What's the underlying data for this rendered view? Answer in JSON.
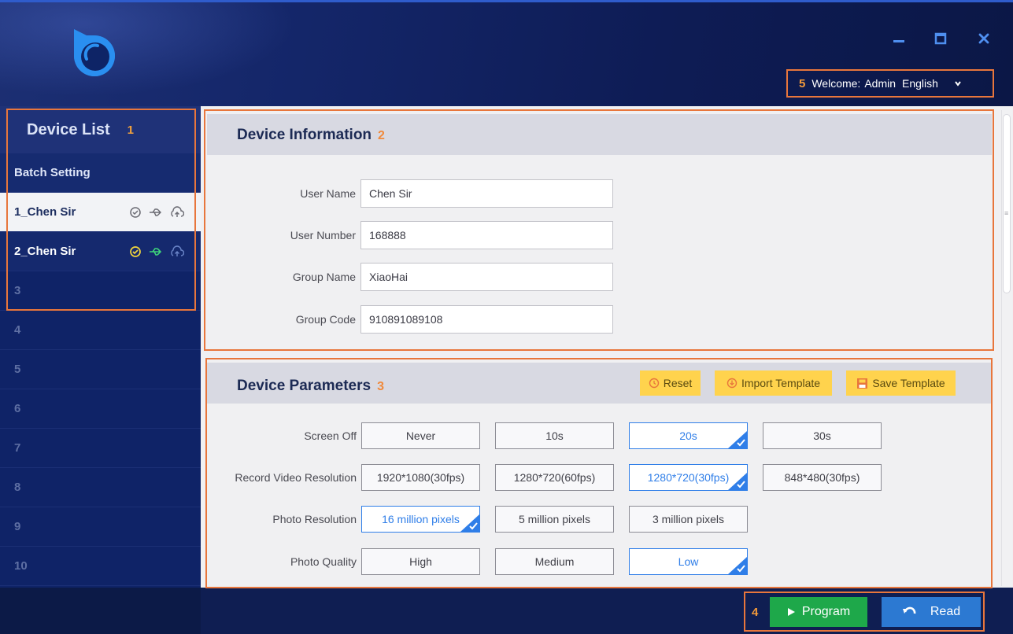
{
  "header": {
    "section_number": "5",
    "welcome_label": "Welcome:",
    "user": "Admin",
    "language": "English",
    "icons": {
      "logo": "app-logo",
      "minimize": "minimize-icon",
      "maximize": "maximize-icon",
      "close": "close-icon",
      "dropdown": "chevron-down-icon"
    }
  },
  "sidebar": {
    "title": "Device List",
    "section_number": "1",
    "batch_label": "Batch Setting",
    "items": [
      {
        "label": "1_Chen Sir",
        "active": true
      },
      {
        "label": "2_Chen Sir",
        "active": false
      },
      {
        "label": "3"
      },
      {
        "label": "4"
      },
      {
        "label": "5"
      },
      {
        "label": "6"
      },
      {
        "label": "7"
      },
      {
        "label": "8"
      },
      {
        "label": "9"
      },
      {
        "label": "10"
      }
    ]
  },
  "device_info": {
    "title": "Device Information",
    "section_number": "2",
    "fields": [
      {
        "label": "User Name",
        "value": "Chen Sir"
      },
      {
        "label": "User Number",
        "value": "168888"
      },
      {
        "label": "Group Name",
        "value": "XiaoHai"
      },
      {
        "label": "Group Code",
        "value": "910891089108"
      }
    ]
  },
  "device_params": {
    "title": "Device Parameters",
    "section_number": "3",
    "buttons": {
      "reset": "Reset",
      "import": "Import Template",
      "save": "Save Template"
    },
    "rows": [
      {
        "label": "Screen Off",
        "options": [
          "Never",
          "10s",
          "20s",
          "30s"
        ],
        "selected": "20s"
      },
      {
        "label": "Record Video Resolution",
        "options": [
          "1920*1080(30fps)",
          "1280*720(60fps)",
          "1280*720(30fps)",
          "848*480(30fps)"
        ],
        "selected": "1280*720(30fps)"
      },
      {
        "label": "Photo Resolution",
        "options": [
          "16 million pixels",
          "5 million pixels",
          "3 million pixels"
        ],
        "selected": "16 million pixels"
      },
      {
        "label": "Photo Quality",
        "options": [
          "High",
          "Medium",
          "Low"
        ],
        "selected": "Low"
      }
    ]
  },
  "footer": {
    "section_number": "4",
    "program": "Program",
    "read": "Read"
  },
  "colors": {
    "accent_orange": "#e8763c",
    "select_blue": "#2f7ee8",
    "program_green": "#1ea84a",
    "read_blue": "#2c79d2",
    "template_yellow": "#ffd34d",
    "sidebar_navy": "#0f2367"
  }
}
